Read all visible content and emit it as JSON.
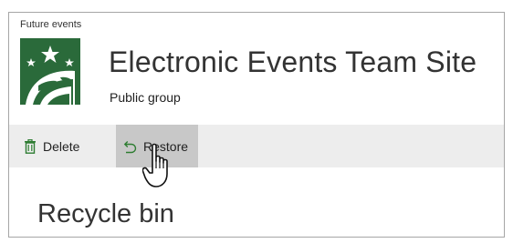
{
  "breadcrumb": "Future events",
  "site": {
    "title": "Electronic Events Team Site",
    "subtitle": "Public group",
    "logo_icon": "globe-stars-logo-icon",
    "logo_color": "#2a6a3a"
  },
  "commandbar": {
    "delete": {
      "label": "Delete",
      "icon": "trash-icon",
      "icon_color": "#2e7d32"
    },
    "restore": {
      "label": "Restore",
      "icon": "undo-arrow-icon",
      "icon_color": "#2e7d32"
    }
  },
  "page": {
    "heading": "Recycle bin"
  },
  "cursor": {
    "icon": "hand-pointer-cursor-icon"
  }
}
